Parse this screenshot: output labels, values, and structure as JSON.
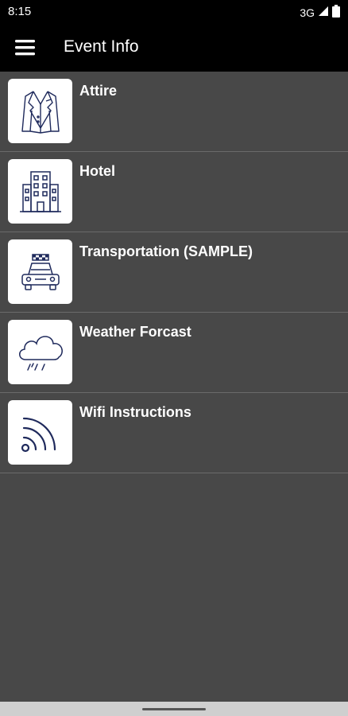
{
  "status_bar": {
    "time": "8:15",
    "network": "3G"
  },
  "app_bar": {
    "title": "Event Info",
    "menu_icon": "hamburger-menu-icon"
  },
  "items": [
    {
      "label": "Attire",
      "icon": "blazer-icon"
    },
    {
      "label": "Hotel",
      "icon": "building-icon"
    },
    {
      "label": "Transportation (SAMPLE)",
      "icon": "taxi-icon"
    },
    {
      "label": "Weather Forcast",
      "icon": "rain-cloud-icon"
    },
    {
      "label": "Wifi Instructions",
      "icon": "wifi-icon"
    }
  ],
  "colors": {
    "icon_stroke": "#1f2a5c",
    "background": "#484848",
    "bars": "#000000"
  }
}
